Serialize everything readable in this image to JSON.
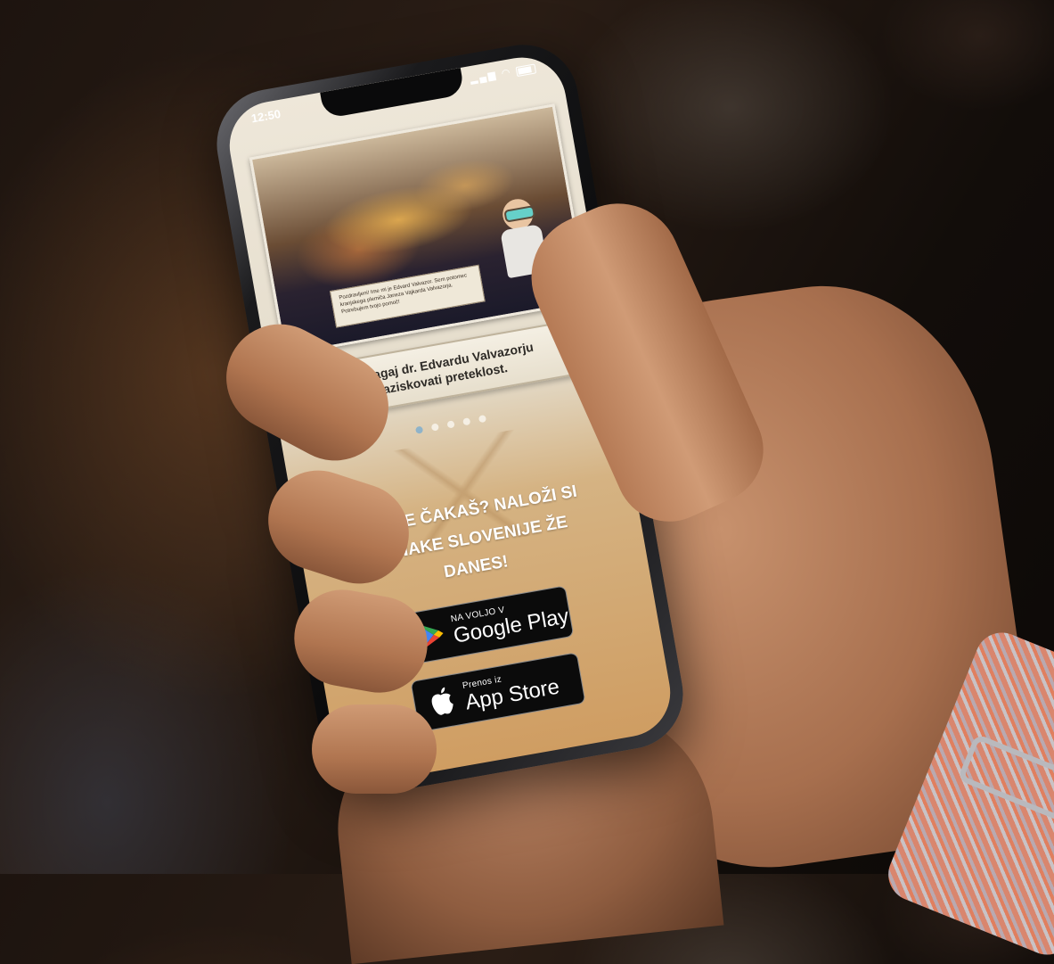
{
  "status_bar": {
    "time": "12:50"
  },
  "map_scroll": {
    "text": "Pozdravljeni! Ime mi je Edvard Valvazor. Sem potomec kranjskega plemiča Janeza Vajkarda Valvazorja. Potrebujem tvojo pomoč!"
  },
  "banner": {
    "text": "Pomagaj dr. Edvardu Valvazorju raziskovati preteklost."
  },
  "carousel": {
    "total": 5,
    "active_index": 0
  },
  "cta": {
    "line1": "KAJ ŠE ČAKAŠ? NALOŽI SI",
    "line2": "JUNAKE SLOVENIJE ŽE",
    "line3": "DANES!"
  },
  "google_play": {
    "small": "NA VOLJO V",
    "big": "Google Play"
  },
  "app_store": {
    "small": "Prenos iz",
    "big": "App Store"
  },
  "colors": {
    "play_green": "#34a853",
    "play_blue": "#4285f4",
    "play_yellow": "#fbbc04",
    "play_red": "#ea4335",
    "active_dot": "#8fb3c9"
  }
}
